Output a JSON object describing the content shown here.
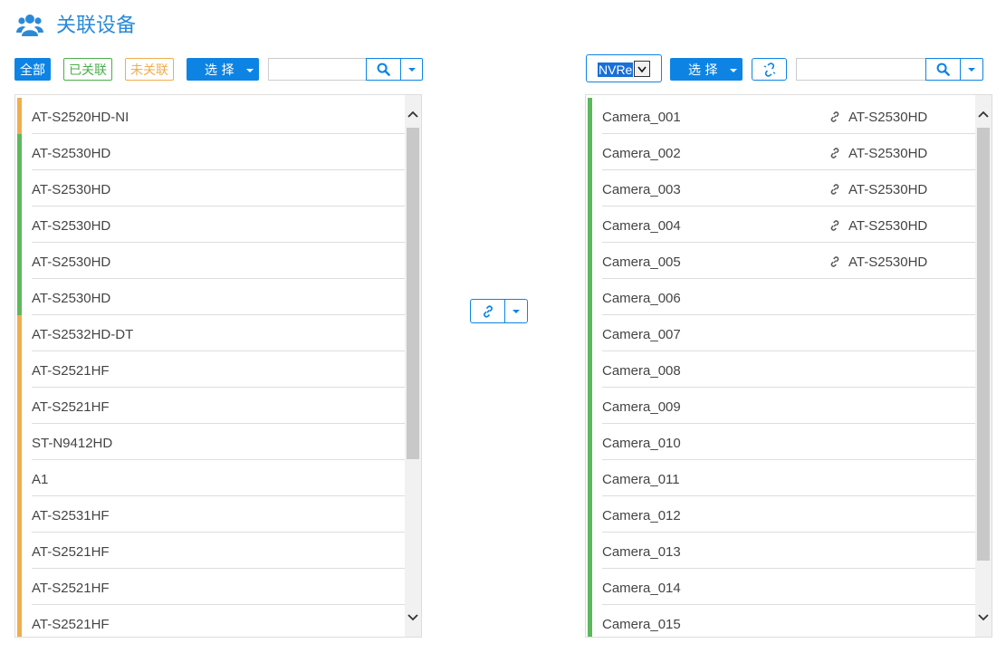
{
  "title": "关联设备",
  "left_toolbar": {
    "all": "全部",
    "associated": "已关联",
    "unassociated": "未关联",
    "select": "选 择",
    "search_value": ""
  },
  "right_toolbar": {
    "nvr_select": "NVRe",
    "select": "选 择",
    "search_value": ""
  },
  "colors": {
    "accent": "#0d84e4",
    "associated": "#5cb85c",
    "unassociated": "#f0ad4e"
  },
  "left_list": [
    {
      "label": "AT-S2520HD-NI",
      "status": "unassociated"
    },
    {
      "label": "AT-S2530HD",
      "status": "associated"
    },
    {
      "label": "AT-S2530HD",
      "status": "associated"
    },
    {
      "label": "AT-S2530HD",
      "status": "associated"
    },
    {
      "label": "AT-S2530HD",
      "status": "associated"
    },
    {
      "label": "AT-S2530HD",
      "status": "associated"
    },
    {
      "label": "AT-S2532HD-DT",
      "status": "unassociated"
    },
    {
      "label": "AT-S2521HF",
      "status": "unassociated"
    },
    {
      "label": "AT-S2521HF",
      "status": "unassociated"
    },
    {
      "label": "ST-N9412HD",
      "status": "unassociated"
    },
    {
      "label": "A1",
      "status": "unassociated"
    },
    {
      "label": "AT-S2531HF",
      "status": "unassociated"
    },
    {
      "label": "AT-S2521HF",
      "status": "unassociated"
    },
    {
      "label": "AT-S2521HF",
      "status": "unassociated"
    },
    {
      "label": "AT-S2521HF",
      "status": "unassociated"
    }
  ],
  "right_list": [
    {
      "label": "Camera_001",
      "linked": "AT-S2530HD"
    },
    {
      "label": "Camera_002",
      "linked": "AT-S2530HD"
    },
    {
      "label": "Camera_003",
      "linked": "AT-S2530HD"
    },
    {
      "label": "Camera_004",
      "linked": "AT-S2530HD"
    },
    {
      "label": "Camera_005",
      "linked": "AT-S2530HD"
    },
    {
      "label": "Camera_006",
      "linked": ""
    },
    {
      "label": "Camera_007",
      "linked": ""
    },
    {
      "label": "Camera_008",
      "linked": ""
    },
    {
      "label": "Camera_009",
      "linked": ""
    },
    {
      "label": "Camera_010",
      "linked": ""
    },
    {
      "label": "Camera_011",
      "linked": ""
    },
    {
      "label": "Camera_012",
      "linked": ""
    },
    {
      "label": "Camera_013",
      "linked": ""
    },
    {
      "label": "Camera_014",
      "linked": ""
    },
    {
      "label": "Camera_015",
      "linked": ""
    }
  ],
  "icons": {
    "title": "users-icon",
    "search": "search-icon",
    "link": "link-icon",
    "unlink": "unlink-icon",
    "dropdown": "caret-down-icon"
  }
}
